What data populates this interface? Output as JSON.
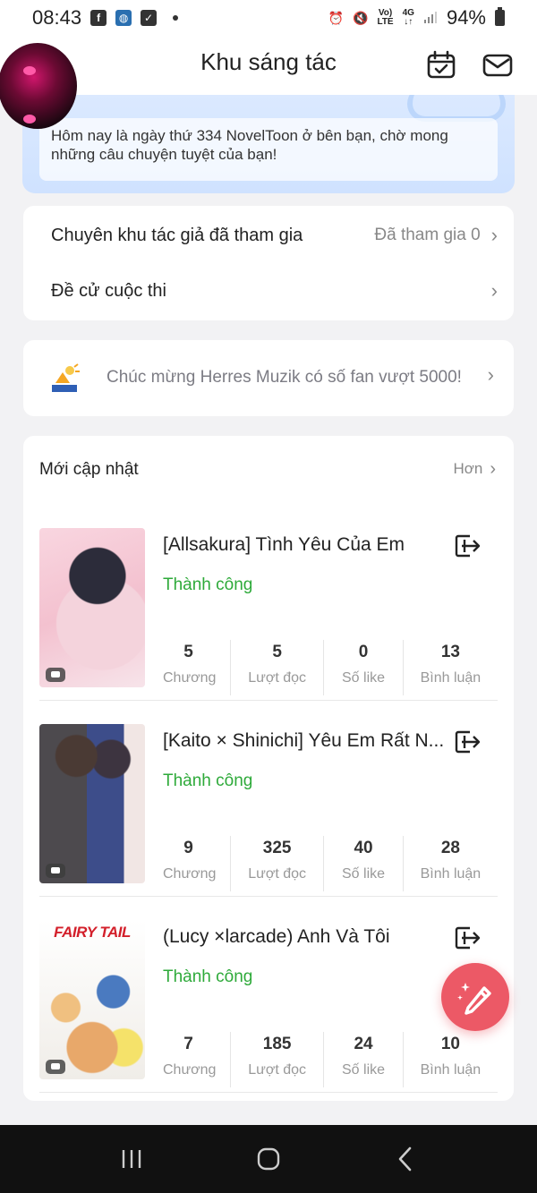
{
  "status_bar": {
    "time": "08:43",
    "battery": "94%",
    "network_top": "Vo)",
    "network_bottom": "LTE",
    "signal_top": "4G"
  },
  "header": {
    "title": "Khu sáng tác"
  },
  "banner": {
    "message": "Hôm nay là ngày thứ 334 NovelToon ở bên bạn, chờ mong những câu chuyện tuyệt của bạn!"
  },
  "menu": {
    "joined_label": "Chuyên khu tác giả đã tham gia",
    "joined_value": "Đã tham gia 0",
    "contest_label": "Đề cử cuộc thi"
  },
  "notice": {
    "text": "Chúc mừng Herres Muzik có số fan vượt 5000!"
  },
  "updates": {
    "title": "Mới cập nhật",
    "more": "Hơn",
    "books": [
      {
        "title": "[Allsakura] Tình Yêu Của Em",
        "status": "Thành công",
        "chapters": "5",
        "chapters_label": "Chương",
        "reads": "5",
        "reads_label": "Lượt đọc",
        "likes": "0",
        "likes_label": "Số like",
        "comments": "13",
        "comments_label": "Bình luận"
      },
      {
        "title": "[Kaito × Shinichi] Yêu Em Rất N...",
        "status": "Thành công",
        "chapters": "9",
        "chapters_label": "Chương",
        "reads": "325",
        "reads_label": "Lượt đọc",
        "likes": "40",
        "likes_label": "Số like",
        "comments": "28",
        "comments_label": "Bình luận"
      },
      {
        "title": "(Lucy ×larcade) Anh Và Tôi",
        "status": "Thành công",
        "cover_text": "FAIRY TAIL",
        "chapters": "7",
        "chapters_label": "Chương",
        "reads": "185",
        "reads_label": "Lượt đọc",
        "likes": "24",
        "likes_label": "Số like",
        "comments": "10",
        "comments_label": "Bình luận"
      }
    ]
  },
  "colors": {
    "accent_green": "#2eaa3a",
    "fab_red": "#ec5966",
    "banner_blue": "#dbe9ff"
  }
}
